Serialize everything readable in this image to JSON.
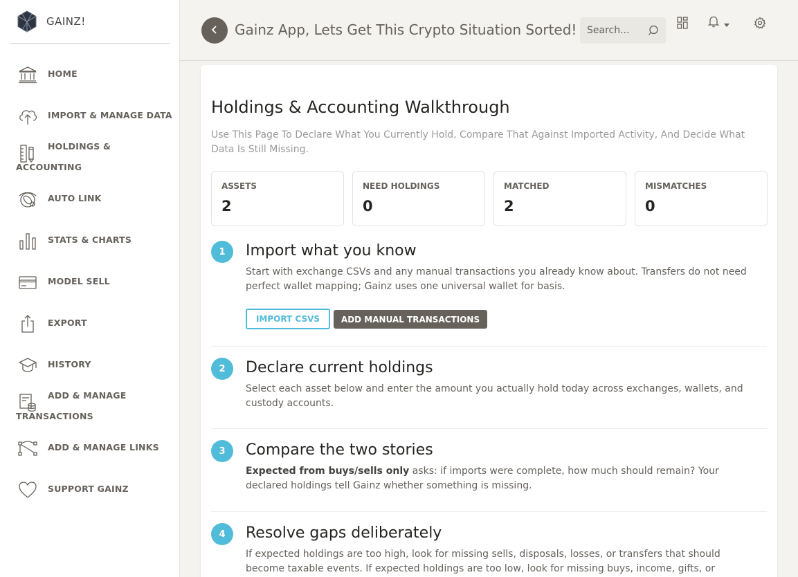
{
  "brand": {
    "name": "GAINZ!"
  },
  "sidebar": {
    "items": [
      {
        "label": "HOME",
        "icon": "bank-icon"
      },
      {
        "label": "IMPORT & MANAGE DATA",
        "icon": "cloud-upload-icon"
      },
      {
        "label_line1": "HOLDINGS &",
        "label_line2": "ACCOUNTING",
        "icon": "ruler-pencil-icon"
      },
      {
        "label": "AUTO LINK",
        "icon": "satellite-icon"
      },
      {
        "label": "STATS & CHARTS",
        "icon": "bar-chart-icon"
      },
      {
        "label": "MODEL SELL",
        "icon": "credit-card-icon"
      },
      {
        "label": "EXPORT",
        "icon": "share-icon"
      },
      {
        "label": "HISTORY",
        "icon": "graduation-cap-icon"
      },
      {
        "label_line1": "ADD & MANAGE",
        "label_line2": "TRANSACTIONS",
        "icon": "transactions-icon"
      },
      {
        "label": "ADD & MANAGE LINKS",
        "icon": "vector-links-icon"
      },
      {
        "label": "SUPPORT GAINZ",
        "icon": "heart-icon"
      }
    ]
  },
  "header": {
    "title": "Gainz App, Lets Get This Crypto Situation Sorted!",
    "search_placeholder": "Search..."
  },
  "main": {
    "title": "Holdings & Accounting Walkthrough",
    "subtitle": "Use This Page To Declare What You Currently Hold, Compare That Against Imported Activity, And Decide What Data Is Still Missing.",
    "stats": [
      {
        "label": "ASSETS",
        "value": "2"
      },
      {
        "label": "NEED HOLDINGS",
        "value": "0"
      },
      {
        "label": "MATCHED",
        "value": "2"
      },
      {
        "label": "MISMATCHES",
        "value": "0"
      }
    ],
    "steps": [
      {
        "num": "1",
        "title": "Import what you know",
        "text": "Start with exchange CSVs and any manual transactions you already know about. Transfers do not need perfect wallet mapping; Gainz uses one universal wallet for basis."
      },
      {
        "num": "2",
        "title": "Declare current holdings",
        "text": "Select each asset below and enter the amount you actually hold today across exchanges, wallets, and custody accounts."
      },
      {
        "num": "3",
        "title": "Compare the two stories",
        "text_bold": "Expected from buys/sells only",
        "text": " asks: if imports were complete, how much should remain? Your declared holdings tell Gainz whether something is missing."
      },
      {
        "num": "4",
        "title": "Resolve gaps deliberately",
        "text": "If expected holdings are too high, look for missing sells, disposals, losses, or transfers that should become taxable events. If expected holdings are too low, look for missing buys, income, gifts, or transfers that need"
      }
    ],
    "buttons": {
      "import_csvs": "IMPORT CSVS",
      "add_manual": "ADD MANUAL TRANSACTIONS"
    }
  },
  "colors": {
    "accent": "#51bcda",
    "dark": "#66615b",
    "background": "#f4f3ef"
  }
}
